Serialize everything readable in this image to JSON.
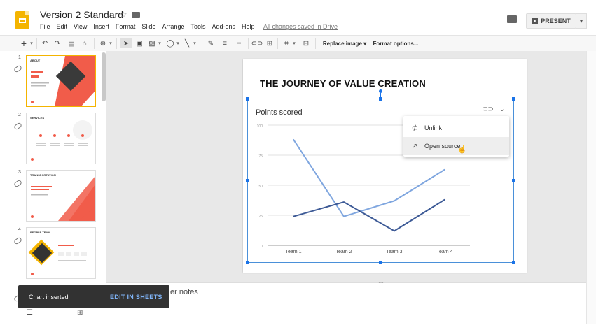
{
  "app": {
    "title": "Version 2 Standard",
    "saved_status": "All changes saved in Drive",
    "present_label": "PRESENT"
  },
  "menu": [
    "File",
    "Edit",
    "View",
    "Insert",
    "Format",
    "Slide",
    "Arrange",
    "Tools",
    "Add-ons",
    "Help"
  ],
  "toolbar": {
    "replace_image_label": "Replace image",
    "format_options_label": "Format options..."
  },
  "filmstrip": {
    "slides": [
      {
        "number": "1",
        "label": "ABOUT",
        "accent": "#f15c4a"
      },
      {
        "number": "2",
        "label": "SERVICES",
        "accent": "#f15c4a"
      },
      {
        "number": "3",
        "label": "TRANSPORTATION",
        "accent": "#f15c4a"
      },
      {
        "number": "4",
        "label": "PEOPLE TEAM",
        "accent": "#f4b400"
      }
    ]
  },
  "slide": {
    "title": "THE JOURNEY OF VALUE CREATION"
  },
  "chart_data": {
    "type": "line",
    "title": "Points scored",
    "categories": [
      "Team 1",
      "Team 2",
      "Team 3",
      "Team 4"
    ],
    "ylim": [
      0,
      100
    ],
    "yticks": [
      0,
      25,
      50,
      75,
      100
    ],
    "series": [
      {
        "values": [
          88,
          24,
          37,
          63
        ],
        "color": "#7fa6df"
      },
      {
        "values": [
          24,
          36,
          12,
          38
        ],
        "color": "#3d5a96"
      }
    ],
    "grid": true
  },
  "chart_menu": {
    "items": [
      {
        "label": "Unlink",
        "icon": "unlink-icon"
      },
      {
        "label": "Open source",
        "icon": "open-external-icon"
      }
    ]
  },
  "notes": {
    "placeholder_suffix": "er notes"
  },
  "toast": {
    "message": "Chart inserted",
    "action": "EDIT IN SHEETS"
  }
}
